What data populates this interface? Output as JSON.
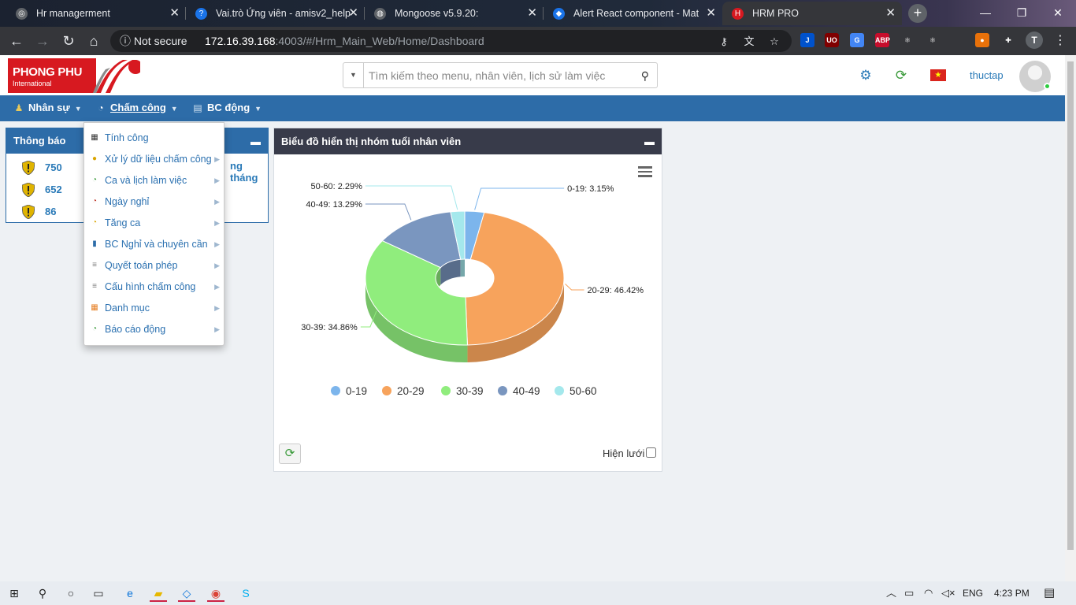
{
  "browser": {
    "tabs": [
      {
        "title": "Hr managerment",
        "icon": "hr-app-icon",
        "glyph": "◎",
        "color": "#5f6368"
      },
      {
        "title": "Vai.trò Ứng viên - amisv2_help",
        "icon": "help-icon",
        "glyph": "?",
        "color": "#1a73e8"
      },
      {
        "title": "Mongoose v5.9.20:",
        "icon": "globe-icon",
        "glyph": "◍",
        "color": "#5f6368"
      },
      {
        "title": "Alert React component - Mat",
        "icon": "material-ui-icon",
        "glyph": "◆",
        "color": "#1a73e8"
      },
      {
        "title": "HRM PRO",
        "icon": "hrm-pro-icon",
        "glyph": "H",
        "color": "#d71920"
      }
    ],
    "active_tab": 4,
    "security_label": "Not secure",
    "url_host": "172.16.39.168",
    "url_rest": ":4003/#/Hrm_Main_Web/Home/Dashboard",
    "extensions": [
      {
        "name": "jira-extension-icon",
        "label": "J",
        "color": "#0052cc"
      },
      {
        "name": "ublock-extension-icon",
        "label": "UO",
        "color": "#800000"
      },
      {
        "name": "google-translate-extension-icon",
        "label": "G",
        "color": "#4285f4"
      },
      {
        "name": "adblock-plus-extension-icon",
        "label": "ABP",
        "color": "#c70d2c"
      },
      {
        "name": "react-devtools-extension-icon",
        "label": "⚛",
        "color": "#35363a"
      },
      {
        "name": "redux-devtools-extension-icon",
        "label": "⚛",
        "color": "#35363a"
      },
      {
        "name": "fox-extension-icon",
        "label": "●",
        "color": "#e8710a"
      },
      {
        "name": "extensions-puzzle-icon",
        "label": "✚",
        "color": "#35363a"
      }
    ],
    "profile_initial": "T"
  },
  "app": {
    "logo_main": "PHONG PHU",
    "logo_sub": "International",
    "search_placeholder": "Tìm kiếm theo menu, nhân viên, lịch sử làm việc",
    "username": "thuctap",
    "menu": [
      {
        "label": "Nhân sự",
        "icon": "people-icon",
        "glyph": "👥"
      },
      {
        "label": "Chấm công",
        "icon": "clock-icon",
        "glyph": "◔"
      },
      {
        "label": "BC động",
        "icon": "report-icon",
        "glyph": "▤"
      }
    ],
    "dropdown": [
      {
        "label": "Tính công",
        "icon": "calculator-icon",
        "glyph": "▦",
        "color": "#333",
        "submenu": false
      },
      {
        "label": "Xử lý dữ liệu chấm công",
        "icon": "coins-icon",
        "glyph": "●",
        "color": "#d9a400",
        "submenu": true
      },
      {
        "label": "Ca và lịch làm việc",
        "icon": "clock-shift-icon",
        "glyph": "◔",
        "color": "#3a9a3a",
        "submenu": true
      },
      {
        "label": "Ngày nghỉ",
        "icon": "clock-leave-icon",
        "glyph": "◔",
        "color": "#c0392b",
        "submenu": true
      },
      {
        "label": "Tăng ca",
        "icon": "clock-overtime-icon",
        "glyph": "◔",
        "color": "#d9a400",
        "submenu": true
      },
      {
        "label": "BC Nghỉ và chuyên cần",
        "icon": "book-icon",
        "glyph": "▮",
        "color": "#2d6ca8",
        "submenu": true
      },
      {
        "label": "Quyết toán phép",
        "icon": "database-icon",
        "glyph": "≡",
        "color": "#777",
        "submenu": true
      },
      {
        "label": "Cấu hình chấm công",
        "icon": "database-config-icon",
        "glyph": "≡",
        "color": "#777",
        "submenu": true
      },
      {
        "label": "Danh mục",
        "icon": "grid-icon",
        "glyph": "▦",
        "color": "#e67e22",
        "submenu": true
      },
      {
        "label": "Báo cáo động",
        "icon": "clock-report-icon",
        "glyph": "◔",
        "color": "#3a9a3a",
        "submenu": true
      }
    ],
    "notifications": {
      "title": "Thông báo",
      "items": [
        "750",
        "652",
        "86"
      ],
      "tail_text": "ng tháng"
    },
    "chart_panel": {
      "title": "Biểu đồ hiển thị nhóm tuổi nhân viên",
      "grid_label": "Hiện lưới"
    }
  },
  "chart_data": {
    "type": "pie",
    "variant": "3d-donut",
    "categories": [
      "0-19",
      "20-29",
      "30-39",
      "40-49",
      "50-60"
    ],
    "values": [
      3.15,
      46.42,
      34.86,
      13.29,
      2.29
    ],
    "colors": [
      "#7cb5ec",
      "#f7a35c",
      "#90ed7d",
      "#7a96bf",
      "#a4e8ec"
    ],
    "data_labels": [
      "0-19: 3.15%",
      "20-29: 46.42%",
      "30-39: 34.86%",
      "40-49: 13.29%",
      "50-60: 2.29%"
    ],
    "legend": "bottom"
  },
  "taskbar": {
    "apps": [
      {
        "name": "start-icon",
        "glyph": "⊞",
        "color": "#222",
        "running": false
      },
      {
        "name": "search-taskbar-icon",
        "glyph": "⚲",
        "color": "#222",
        "running": false
      },
      {
        "name": "cortana-icon",
        "glyph": "○",
        "color": "#222",
        "running": false
      },
      {
        "name": "task-view-icon",
        "glyph": "▭",
        "color": "#222",
        "running": false
      },
      {
        "name": "edge-icon",
        "glyph": "e",
        "color": "#0a74da",
        "running": false
      },
      {
        "name": "file-explorer-icon",
        "glyph": "▰",
        "color": "#e6b800",
        "running": true
      },
      {
        "name": "vscode-icon",
        "glyph": "◇",
        "color": "#0a74da",
        "running": true
      },
      {
        "name": "chrome-icon",
        "glyph": "◉",
        "color": "#db4437",
        "running": true
      },
      {
        "name": "skype-icon",
        "glyph": "S",
        "color": "#00aff0",
        "running": false
      }
    ],
    "lang": "ENG",
    "time": "4:23 PM"
  }
}
